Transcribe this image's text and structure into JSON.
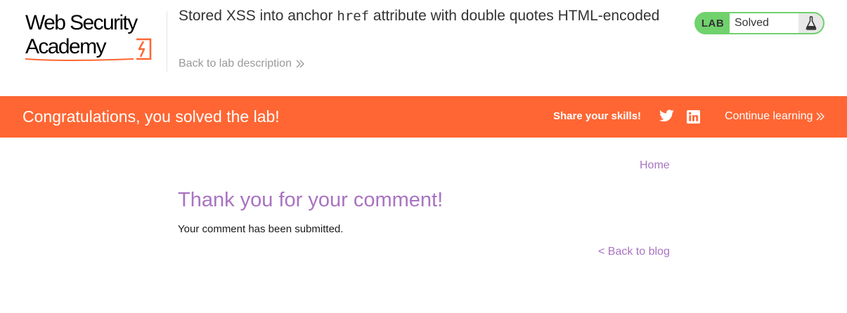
{
  "header": {
    "logo_line1": "Web Security",
    "logo_line2": "Academy",
    "lab_title_part1": "Stored XSS into anchor ",
    "lab_title_code": "href",
    "lab_title_part2": " attribute with double quotes HTML-encoded",
    "back_to_description": "Back to lab description",
    "lab_badge_label": "LAB",
    "lab_status": "Solved",
    "accent_color": "#ff6633",
    "solved_color": "#70d16d"
  },
  "banner": {
    "message": "Congratulations, you solved the lab!",
    "share_label": "Share your skills!",
    "share_icons": [
      "twitter-icon",
      "linkedin-icon"
    ],
    "continue_label": "Continue learning"
  },
  "main": {
    "nav_home": "Home",
    "title": "Thank you for your comment!",
    "message": "Your comment has been submitted.",
    "back_to_blog": "< Back to blog",
    "link_color": "#a973c2"
  }
}
